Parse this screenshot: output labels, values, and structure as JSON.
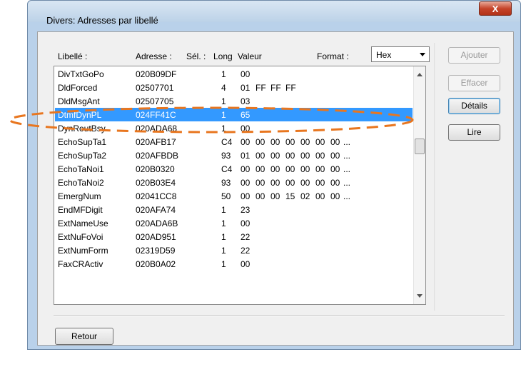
{
  "window": {
    "title": "Divers: Adresses par libellé",
    "close_glyph": "X"
  },
  "headers": {
    "libelle": "Libellé :",
    "adresse": "Adresse :",
    "sel": "Sél. :",
    "long": "Long",
    "valeur": "Valeur",
    "format": "Format :"
  },
  "format_select": {
    "value": "Hex"
  },
  "buttons": {
    "ajouter": "Ajouter",
    "effacer": "Effacer",
    "details": "Détails",
    "lire": "Lire",
    "retour": "Retour"
  },
  "rows": [
    {
      "name": "DivTxtGoPo",
      "addr": "020B09DF",
      "len": "1",
      "vals": [
        "00"
      ]
    },
    {
      "name": "DldForced",
      "addr": "02507701",
      "len": "4",
      "vals": [
        "01",
        "FF",
        "FF",
        "FF"
      ]
    },
    {
      "name": "DldMsgAnt",
      "addr": "02507705",
      "len": "1",
      "vals": [
        "03"
      ]
    },
    {
      "name": "DtmfDynPL",
      "addr": "024FF41C",
      "len": "1",
      "vals": [
        "65"
      ],
      "selected": true
    },
    {
      "name": "DynRoutBsy",
      "addr": "020ADA68",
      "len": "1",
      "vals": [
        "00"
      ]
    },
    {
      "name": "EchoSupTa1",
      "addr": "020AFB17",
      "len": "C4",
      "vals": [
        "00",
        "00",
        "00",
        "00",
        "00",
        "00",
        "00"
      ],
      "more": "..."
    },
    {
      "name": "EchoSupTa2",
      "addr": "020AFBDB",
      "len": "93",
      "vals": [
        "01",
        "00",
        "00",
        "00",
        "00",
        "00",
        "00"
      ],
      "more": "..."
    },
    {
      "name": "EchoTaNoi1",
      "addr": "020B0320",
      "len": "C4",
      "vals": [
        "00",
        "00",
        "00",
        "00",
        "00",
        "00",
        "00"
      ],
      "more": "..."
    },
    {
      "name": "EchoTaNoi2",
      "addr": "020B03E4",
      "len": "93",
      "vals": [
        "00",
        "00",
        "00",
        "00",
        "00",
        "00",
        "00"
      ],
      "more": "..."
    },
    {
      "name": "EmergNum",
      "addr": "02041CC8",
      "len": "50",
      "vals": [
        "00",
        "00",
        "00",
        "15",
        "02",
        "00",
        "00"
      ],
      "more": "..."
    },
    {
      "name": "EndMFDigit",
      "addr": "020AFA74",
      "len": "1",
      "vals": [
        "23"
      ]
    },
    {
      "name": "ExtNameUse",
      "addr": "020ADA6B",
      "len": "1",
      "vals": [
        "00"
      ]
    },
    {
      "name": "ExtNuFoVoi",
      "addr": "020AD951",
      "len": "1",
      "vals": [
        "22"
      ]
    },
    {
      "name": "ExtNumForm",
      "addr": "02319D59",
      "len": "1",
      "vals": [
        "22"
      ]
    },
    {
      "name": "FaxCRActiv",
      "addr": "020B0A02",
      "len": "1",
      "vals": [
        "00"
      ]
    }
  ],
  "colors": {
    "selection": "#3399ff",
    "annotation": "#e8761f"
  },
  "icons": {
    "close": "close-icon",
    "dropdown": "chevron-down-icon",
    "scroll_up": "arrow-up-icon",
    "scroll_down": "arrow-down-icon"
  }
}
